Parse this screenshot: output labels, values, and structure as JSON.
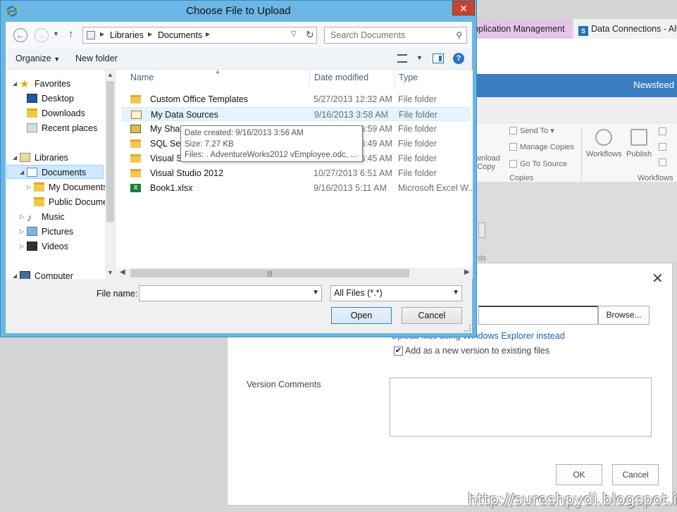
{
  "background": {
    "tabs": [
      "Application Management",
      "Data Connections - All"
    ],
    "top_right_link": "Newsfeed",
    "ribbon": {
      "send_to": "Send To",
      "manage_copies": "Manage Copies",
      "go_to_source": "Go To Source",
      "download_copy": "Download a Copy",
      "group_copies": "Copies",
      "workflows": "Workflows",
      "publish": "Publish",
      "group_workflows": "Workflows"
    },
    "partial_text": "rds"
  },
  "upload_modal": {
    "browse_label": "Browse...",
    "upload_link": "Upload files using Windows Explorer instead",
    "add_version_checked": true,
    "add_version_label": "Add as a new version to existing files",
    "version_comments_label": "Version Comments",
    "ok_label": "OK",
    "cancel_label": "Cancel"
  },
  "dialog": {
    "title": "Choose File to Upload",
    "breadcrumbs": [
      "Libraries",
      "Documents"
    ],
    "search_placeholder": "Search Documents",
    "toolbar": {
      "organize": "Organize",
      "new_folder": "New folder"
    },
    "tree": {
      "favorites": "Favorites",
      "desktop": "Desktop",
      "downloads": "Downloads",
      "recent_places": "Recent places",
      "libraries": "Libraries",
      "documents": "Documents",
      "my_documents": "My Documents",
      "public_documents": "Public Documents",
      "music": "Music",
      "pictures": "Pictures",
      "videos": "Videos",
      "computer": "Computer"
    },
    "columns": {
      "name": "Name",
      "date": "Date modified",
      "type": "Type"
    },
    "files": [
      {
        "name": "Custom Office Templates",
        "date": "5/27/2013 12:32 AM",
        "type": "File folder",
        "icon": "folder-icon"
      },
      {
        "name": "My Data Sources",
        "date": "9/16/2013 3:58 AM",
        "type": "File folder",
        "icon": "data-sources-folder-icon"
      },
      {
        "name": "My Shapes",
        "date": "10/27/2013 6:59 AM",
        "type": "File folder",
        "icon": "shapes-folder-icon"
      },
      {
        "name": "SQL Server Management Studio",
        "date": "10/27/2013 6:49 AM",
        "type": "File folder",
        "icon": "folder-icon"
      },
      {
        "name": "Visual Studio 2010",
        "date": "10/27/2013 6:45 AM",
        "type": "File folder",
        "icon": "folder-icon"
      },
      {
        "name": "Visual Studio 2012",
        "date": "10/27/2013 6:51 AM",
        "type": "File folder",
        "icon": "folder-icon"
      },
      {
        "name": "Book1.xlsx",
        "date": "9/16/2013 5:11 AM",
        "type": "Microsoft Excel W...",
        "icon": "excel-file-icon"
      }
    ],
    "tooltip": {
      "created": "Date created: 9/16/2013 3:56 AM",
      "size": "Size: 7.27 KB",
      "files": "Files: . AdventureWorks2012 vEmployee.odc, ..."
    },
    "file_name_label": "File name:",
    "file_name_value": "",
    "filter_value": "All Files (*.*)",
    "open_label": "Open",
    "cancel_label": "Cancel"
  },
  "watermark": "http://sureshpydi.blogspot.in/"
}
